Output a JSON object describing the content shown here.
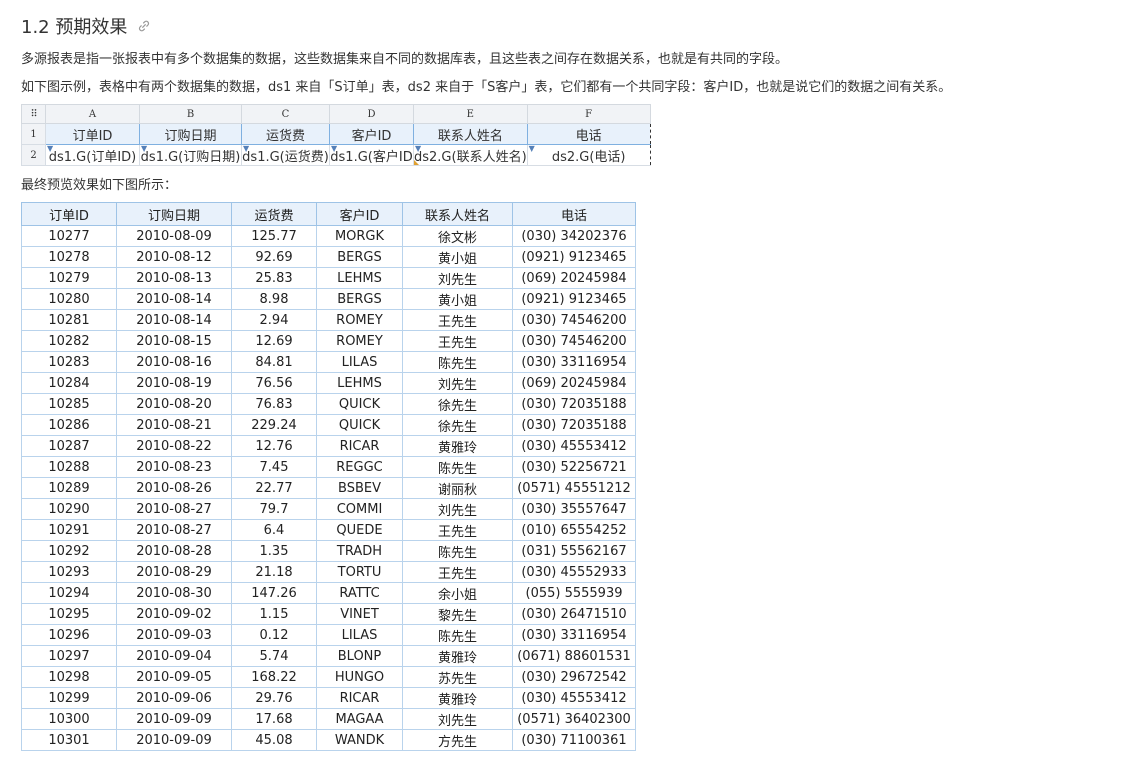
{
  "heading": "1.2 预期效果",
  "para1": "多源报表是指一张报表中有多个数据集的数据，这些数据集来自不同的数据库表，且这些表之间存在数据关系，也就是有共同的字段。",
  "para2": "如下图示例，表格中有两个数据集的数据，ds1 来自「S订单」表，ds2 来自于「S客户」表，它们都有一个共同字段：客户ID，也就是说它们的数据之间有关系。",
  "para3": "最终预览效果如下图所示：",
  "designer": {
    "corner": "⠿",
    "columns": [
      "A",
      "B",
      "C",
      "D",
      "E",
      "F"
    ],
    "row_numbers": [
      "1",
      "2"
    ],
    "header_row": [
      "订单ID",
      "订购日期",
      "运货费",
      "客户ID",
      "联系人姓名",
      "电话"
    ],
    "formula_row": [
      "ds1.G(订单ID)",
      "ds1.G(订购日期)",
      "ds1.G(运货费)",
      "ds1.G(客户ID",
      "ds2.G(联系人姓名)",
      "ds2.G(电话)"
    ]
  },
  "preview": {
    "headers": [
      "订单ID",
      "订购日期",
      "运货费",
      "客户ID",
      "联系人姓名",
      "电话"
    ],
    "rows": [
      [
        "10277",
        "2010-08-09",
        "125.77",
        "MORGK",
        "徐文彬",
        "(030) 34202376"
      ],
      [
        "10278",
        "2010-08-12",
        "92.69",
        "BERGS",
        "黄小姐",
        "(0921) 9123465"
      ],
      [
        "10279",
        "2010-08-13",
        "25.83",
        "LEHMS",
        "刘先生",
        "(069) 20245984"
      ],
      [
        "10280",
        "2010-08-14",
        "8.98",
        "BERGS",
        "黄小姐",
        "(0921) 9123465"
      ],
      [
        "10281",
        "2010-08-14",
        "2.94",
        "ROMEY",
        "王先生",
        "(030) 74546200"
      ],
      [
        "10282",
        "2010-08-15",
        "12.69",
        "ROMEY",
        "王先生",
        "(030) 74546200"
      ],
      [
        "10283",
        "2010-08-16",
        "84.81",
        "LILAS",
        "陈先生",
        "(030) 33116954"
      ],
      [
        "10284",
        "2010-08-19",
        "76.56",
        "LEHMS",
        "刘先生",
        "(069) 20245984"
      ],
      [
        "10285",
        "2010-08-20",
        "76.83",
        "QUICK",
        "徐先生",
        "(030) 72035188"
      ],
      [
        "10286",
        "2010-08-21",
        "229.24",
        "QUICK",
        "徐先生",
        "(030) 72035188"
      ],
      [
        "10287",
        "2010-08-22",
        "12.76",
        "RICAR",
        "黄雅玲",
        "(030) 45553412"
      ],
      [
        "10288",
        "2010-08-23",
        "7.45",
        "REGGC",
        "陈先生",
        "(030) 52256721"
      ],
      [
        "10289",
        "2010-08-26",
        "22.77",
        "BSBEV",
        "谢丽秋",
        "(0571) 45551212"
      ],
      [
        "10290",
        "2010-08-27",
        "79.7",
        "COMMI",
        "刘先生",
        "(030) 35557647"
      ],
      [
        "10291",
        "2010-08-27",
        "6.4",
        "QUEDE",
        "王先生",
        "(010) 65554252"
      ],
      [
        "10292",
        "2010-08-28",
        "1.35",
        "TRADH",
        "陈先生",
        "(031) 55562167"
      ],
      [
        "10293",
        "2010-08-29",
        "21.18",
        "TORTU",
        "王先生",
        "(030) 45552933"
      ],
      [
        "10294",
        "2010-08-30",
        "147.26",
        "RATTC",
        "余小姐",
        "(055) 5555939"
      ],
      [
        "10295",
        "2010-09-02",
        "1.15",
        "VINET",
        "黎先生",
        "(030) 26471510"
      ],
      [
        "10296",
        "2010-09-03",
        "0.12",
        "LILAS",
        "陈先生",
        "(030) 33116954"
      ],
      [
        "10297",
        "2010-09-04",
        "5.74",
        "BLONP",
        "黄雅玲",
        "(0671) 88601531"
      ],
      [
        "10298",
        "2010-09-05",
        "168.22",
        "HUNGO",
        "苏先生",
        "(030) 29672542"
      ],
      [
        "10299",
        "2010-09-06",
        "29.76",
        "RICAR",
        "黄雅玲",
        "(030) 45553412"
      ],
      [
        "10300",
        "2010-09-09",
        "17.68",
        "MAGAA",
        "刘先生",
        "(0571) 36402300"
      ],
      [
        "10301",
        "2010-09-09",
        "45.08",
        "WANDK",
        "方先生",
        "(030) 71100361"
      ]
    ]
  }
}
